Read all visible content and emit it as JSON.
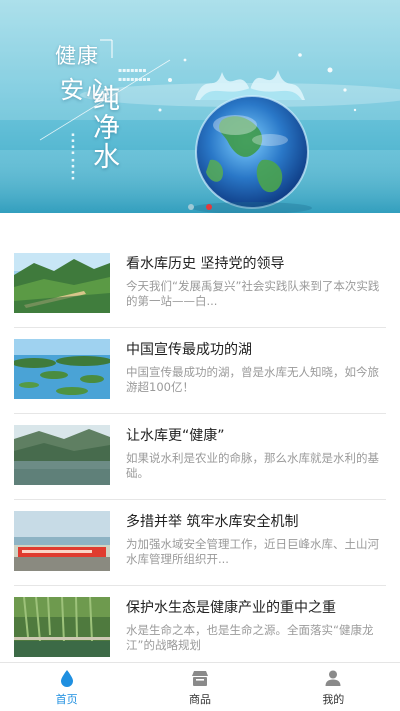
{
  "banner": {
    "title_line1": "健康",
    "title_line2": "安心",
    "title_vertical": "纯净水",
    "active_slide": 2,
    "slides": 2
  },
  "news": [
    {
      "title": "看水库历史 坚持党的领导",
      "desc": "今天我们“发展禹复兴”社会实践队来到了本次实践的第一站——白...",
      "thumb_icon": "dam-bridge-photo"
    },
    {
      "title": "中国宣传最成功的湖",
      "desc": "中国宣传最成功的湖，曾是水库无人知晓，如今旅游超100亿！",
      "thumb_icon": "lake-islands-photo"
    },
    {
      "title": "让水库更“健康”",
      "desc": "如果说水利是农业的命脉，那么水库就是水利的基础。",
      "thumb_icon": "reservoir-hills-photo"
    },
    {
      "title": "多措并举 筑牢水库安全机制",
      "desc": "为加强水域安全管理工作，近日巨峰水库、土山河水库管理所组织开...",
      "thumb_icon": "banner-crowd-photo"
    },
    {
      "title": "保护水生态是健康产业的重中之重",
      "desc": "水是生命之本，也是生命之源。全面落实“健康龙江”的战略规划",
      "thumb_icon": "willow-lakeside-photo"
    }
  ],
  "tabbar": {
    "home_label": "首页",
    "products_label": "商品",
    "mine_label": "我的",
    "active_color": "#1f8fe0",
    "inactive_color": "#888888"
  }
}
